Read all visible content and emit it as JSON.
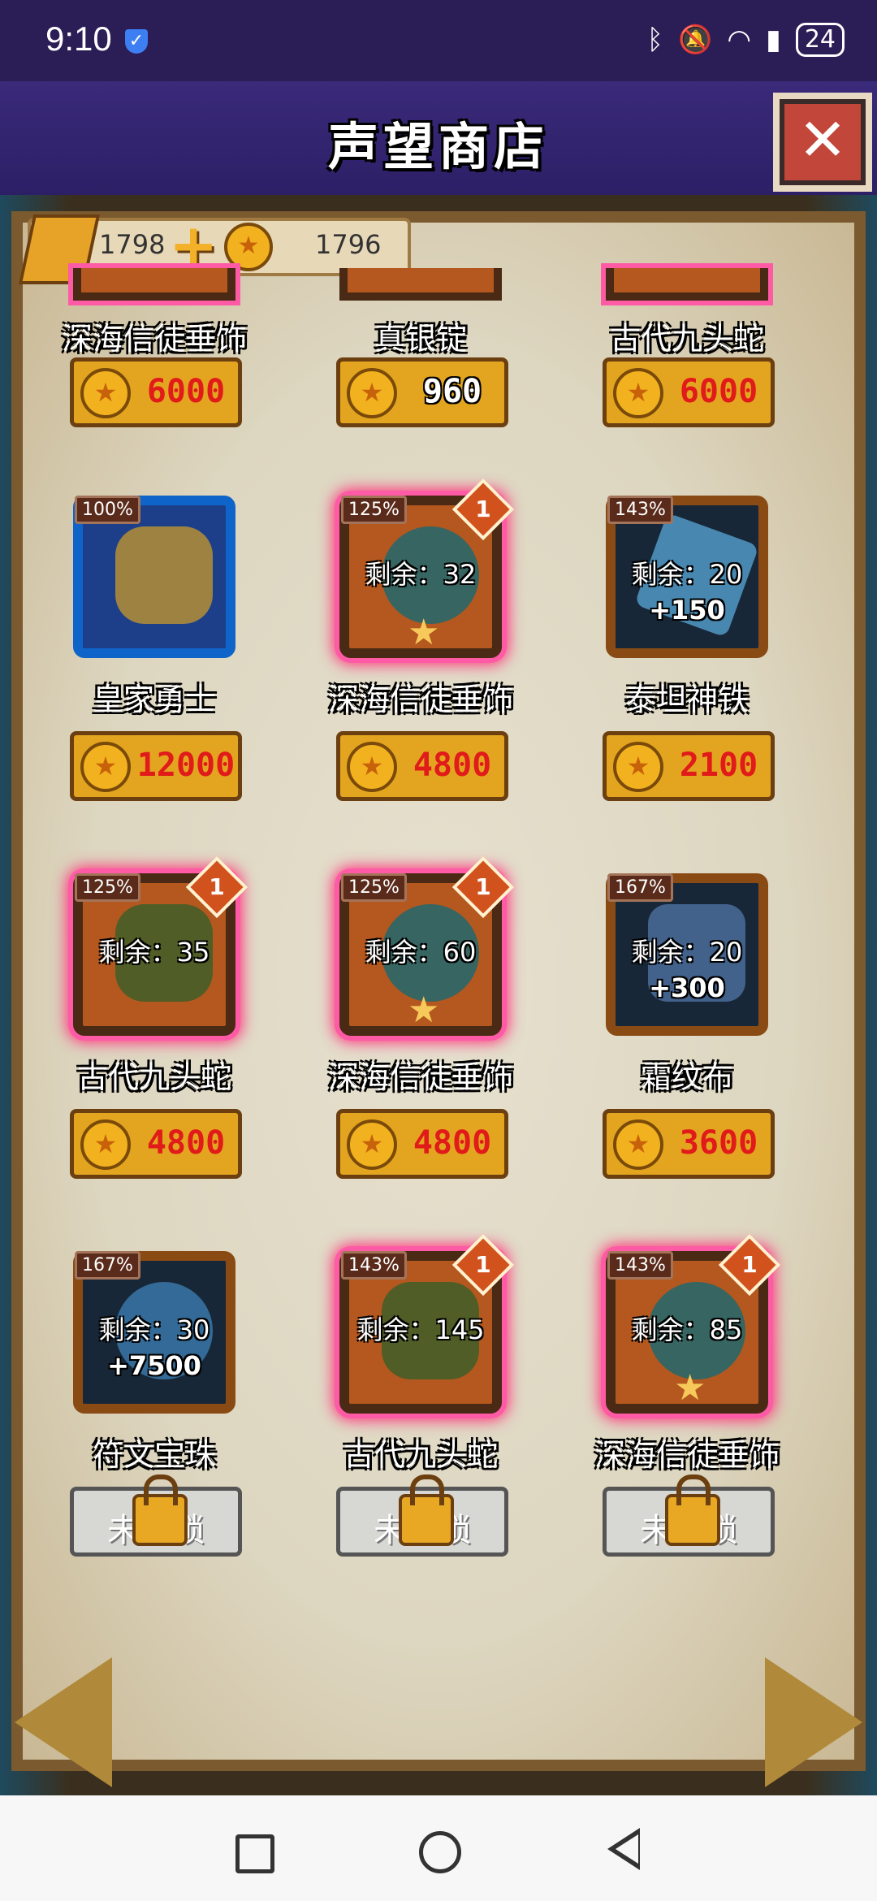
{
  "status_bar": {
    "time": "9:10",
    "battery": "24"
  },
  "header": {
    "title": "声望商店",
    "close_label": "✕"
  },
  "currency": {
    "gold": "1798",
    "plus": "+",
    "coins": "1796"
  },
  "top_row": [
    {
      "name": "深海信徒垂饰",
      "price": "6000",
      "price_style": "red"
    },
    {
      "name": "真银锭",
      "price": "960",
      "price_style": "white"
    },
    {
      "name": "古代九头蛇",
      "price": "6000",
      "price_style": "red"
    }
  ],
  "items": [
    {
      "name": "皇家勇士",
      "bonus_pct": "100%",
      "remain": "",
      "extra": "",
      "level_badge": "",
      "price": "12000",
      "locked": false,
      "frame": "blue",
      "art": "warrior"
    },
    {
      "name": "深海信徒垂饰",
      "bonus_pct": "125%",
      "remain": "剩余：32",
      "extra": "",
      "level_badge": "1",
      "price": "4800",
      "locked": false,
      "frame": "glow",
      "art": "amulet"
    },
    {
      "name": "泰坦神铁",
      "bonus_pct": "143%",
      "remain": "剩余：20",
      "extra": "+150",
      "level_badge": "",
      "price": "2100",
      "locked": false,
      "frame": "dark",
      "art": "crystal"
    },
    {
      "name": "古代九头蛇",
      "bonus_pct": "125%",
      "remain": "剩余：35",
      "extra": "",
      "level_badge": "1",
      "price": "4800",
      "locked": false,
      "frame": "glow",
      "art": "hydra"
    },
    {
      "name": "深海信徒垂饰",
      "bonus_pct": "125%",
      "remain": "剩余：60",
      "extra": "",
      "level_badge": "1",
      "price": "4800",
      "locked": false,
      "frame": "glow",
      "art": "amulet"
    },
    {
      "name": "霜纹布",
      "bonus_pct": "167%",
      "remain": "剩余：20",
      "extra": "+300",
      "level_badge": "",
      "price": "3600",
      "locked": false,
      "frame": "dark",
      "art": "cloth"
    },
    {
      "name": "符文宝珠",
      "bonus_pct": "167%",
      "remain": "剩余：30",
      "extra": "+7500",
      "level_badge": "",
      "price": "未解锁",
      "locked": true,
      "frame": "dark",
      "art": "orb"
    },
    {
      "name": "古代九头蛇",
      "bonus_pct": "143%",
      "remain": "剩余：145",
      "extra": "",
      "level_badge": "1",
      "price": "未解锁",
      "locked": true,
      "frame": "glow",
      "art": "hydra"
    },
    {
      "name": "深海信徒垂饰",
      "bonus_pct": "143%",
      "remain": "剩余：85",
      "extra": "",
      "level_badge": "1",
      "price": "未解锁",
      "locked": true,
      "frame": "glow",
      "art": "amulet"
    }
  ],
  "colors": {
    "glow": "#ff2f7a",
    "price_red": "#e11a1a",
    "gold_button": "#e3a51f"
  }
}
